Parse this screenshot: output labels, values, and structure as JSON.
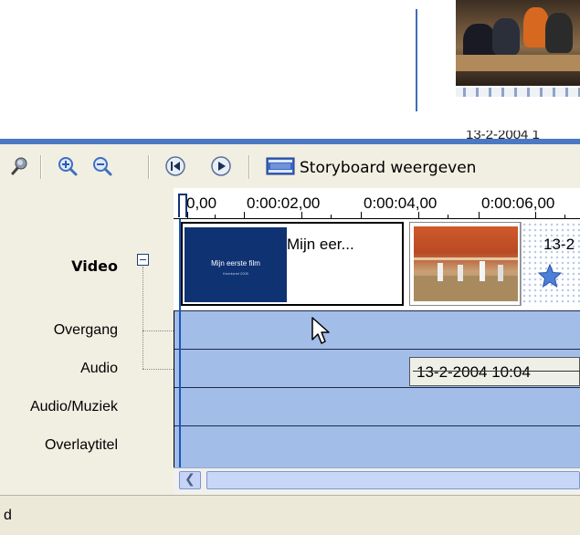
{
  "collection": {
    "thumbnail_date": "13-2-2004 1"
  },
  "toolbar": {
    "icons": [
      "microphone-icon",
      "zoom-in-icon",
      "zoom-out-icon",
      "rewind-icon",
      "play-icon",
      "storyboard-icon"
    ],
    "storyboard_label": "Storyboard weergeven"
  },
  "ruler": {
    "labels": [
      "0,00",
      "0:00:02,00",
      "0:00:04,00",
      "0:00:06,00"
    ]
  },
  "tracks": {
    "video": "Video",
    "overgang": "Overgang",
    "audio": "Audio",
    "audio_muziek": "Audio/Muziek",
    "overlaytitel": "Overlaytitel"
  },
  "clips": {
    "title_clip_label": "Mijn eer...",
    "title_clip_thumb_title": "Mijn eerste film",
    "title_clip_thumb_sub": "Kennisnet 2005",
    "photo_clip_label": "13-2",
    "audio_clip_label": "13-2-2004 10:04"
  },
  "status": {
    "text": "d"
  },
  "colors": {
    "timeline_blue": "#a3bde9",
    "pane_border": "#4b78c2",
    "toolbar_bg": "#f1efe2"
  }
}
